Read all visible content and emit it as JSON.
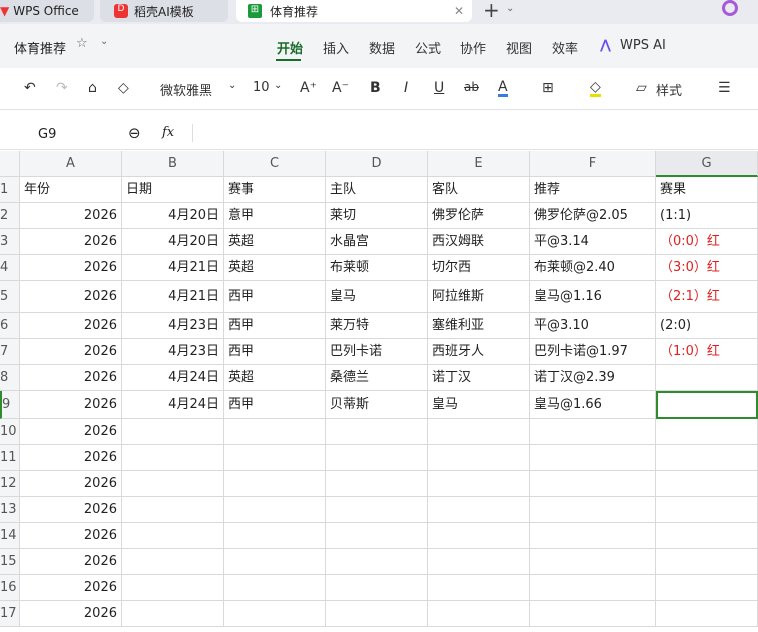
{
  "tabs": [
    {
      "label": "WPS Office"
    },
    {
      "label": "稻壳AI模板"
    },
    {
      "label": "体育推荐",
      "active": true
    }
  ],
  "doc_title": "体育推荐",
  "menu": [
    "开始",
    "插入",
    "数据",
    "公式",
    "协作",
    "视图",
    "效率",
    "WPS AI"
  ],
  "toolbar": {
    "font": "微软雅黑",
    "size": "10",
    "style": "样式"
  },
  "formula": {
    "cell_ref": "G9",
    "fx": "fx"
  },
  "columns": [
    "A",
    "B",
    "C",
    "D",
    "E",
    "F",
    "G"
  ],
  "row_numbers": [
    "1",
    "2",
    "3",
    "4",
    "5",
    "6",
    "7",
    "8",
    "9",
    "10",
    "11",
    "12",
    "13",
    "14",
    "15",
    "16",
    "17"
  ],
  "rows": [
    [
      "年份",
      "日期",
      "赛事",
      "主队",
      "客队",
      "推荐",
      "赛果"
    ],
    [
      "2026",
      "4月20日",
      "意甲",
      "莱切",
      "佛罗伦萨",
      "佛罗伦萨@2.05",
      "(1:1)"
    ],
    [
      "2026",
      "4月20日",
      "英超",
      "水晶宫",
      "西汉姆联",
      "平@3.14",
      "（0:0）红"
    ],
    [
      "2026",
      "4月21日",
      "英超",
      "布莱顿",
      "切尔西",
      "布莱顿@2.40",
      "（3:0）红"
    ],
    [
      "2026",
      "4月21日",
      "西甲",
      "皇马",
      "阿拉维斯",
      "皇马@1.16",
      "（2:1）红"
    ],
    [
      "2026",
      "4月23日",
      "西甲",
      "莱万特",
      "塞维利亚",
      "平@3.10",
      "(2:0)"
    ],
    [
      "2026",
      "4月23日",
      "西甲",
      "巴列卡诺",
      "西班牙人",
      "巴列卡诺@1.97",
      "（1:0）红"
    ],
    [
      "2026",
      "4月24日",
      "英超",
      "桑德兰",
      "诺丁汉",
      "诺丁汉@2.39",
      ""
    ],
    [
      "2026",
      "4月24日",
      "西甲",
      "贝蒂斯",
      "皇马",
      "皇马@1.66",
      ""
    ],
    [
      "2026",
      "",
      "",
      "",
      "",
      "",
      ""
    ],
    [
      "2026",
      "",
      "",
      "",
      "",
      "",
      ""
    ],
    [
      "2026",
      "",
      "",
      "",
      "",
      "",
      ""
    ],
    [
      "2026",
      "",
      "",
      "",
      "",
      "",
      ""
    ],
    [
      "2026",
      "",
      "",
      "",
      "",
      "",
      ""
    ],
    [
      "2026",
      "",
      "",
      "",
      "",
      "",
      ""
    ],
    [
      "2026",
      "",
      "",
      "",
      "",
      "",
      ""
    ],
    [
      "2026",
      "",
      "",
      "",
      "",
      "",
      ""
    ]
  ],
  "colors": {
    "accent": "#1b6b2a",
    "win": "#e02020",
    "selection": "#2e8b2e"
  }
}
